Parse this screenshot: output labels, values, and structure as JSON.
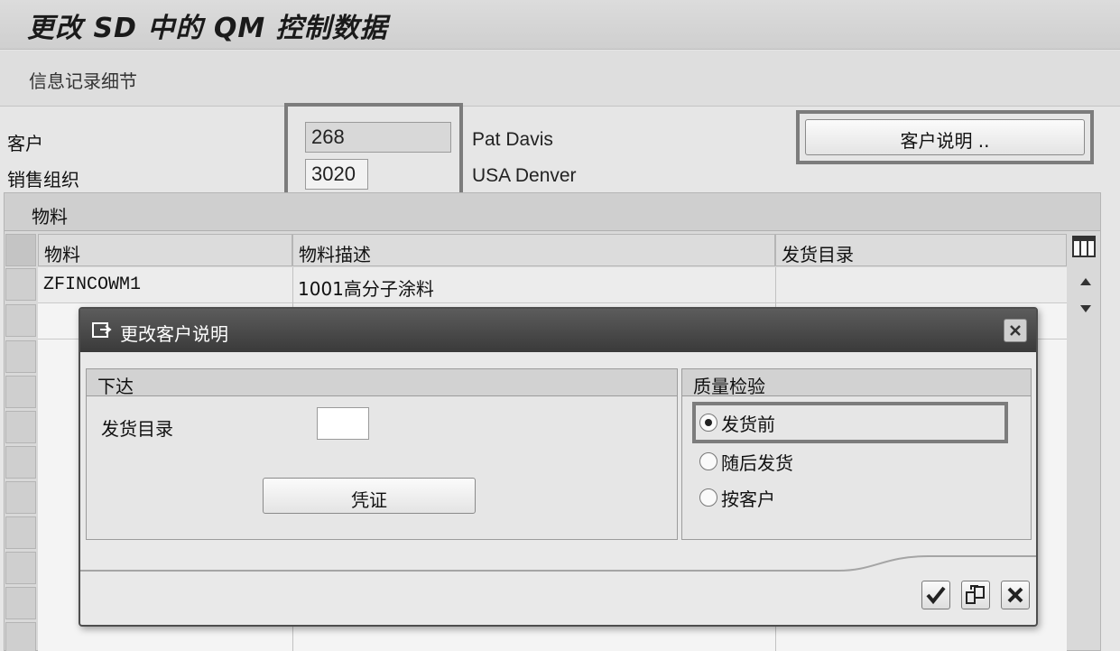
{
  "window": {
    "title": "更改 SD 中的 QM 控制数据"
  },
  "toolbar": {
    "info_record_details": "信息记录细节"
  },
  "header": {
    "customer_label": "客户",
    "customer_value": "268",
    "customer_name": "Pat Davis",
    "sales_org_label": "销售组织",
    "sales_org_value": "3020",
    "sales_org_name": "USA Denver",
    "customer_desc_button": "客户说明 .."
  },
  "materials": {
    "section_title": "物料",
    "columns": [
      "物料",
      "物料描述",
      "发货目录"
    ],
    "rows": [
      {
        "material": "ZFINCOWM1",
        "description": "1001高分子涂料",
        "catalog": ""
      }
    ]
  },
  "dialog": {
    "title": "更改客户说明",
    "release_group": {
      "title": "下达",
      "catalog_label": "发货目录",
      "catalog_value": "",
      "certificate_button": "凭证"
    },
    "qi_group": {
      "title": "质量检验",
      "options": [
        {
          "label": "发货前",
          "selected": true
        },
        {
          "label": "随后发货",
          "selected": false
        },
        {
          "label": "按客户",
          "selected": false
        }
      ]
    },
    "footer_icons": [
      "confirm-check-icon",
      "copy-icon",
      "cancel-x-icon"
    ]
  },
  "colors": {
    "dialog_title_bg": "#474747",
    "highlight_border": "#7c7c7c"
  }
}
